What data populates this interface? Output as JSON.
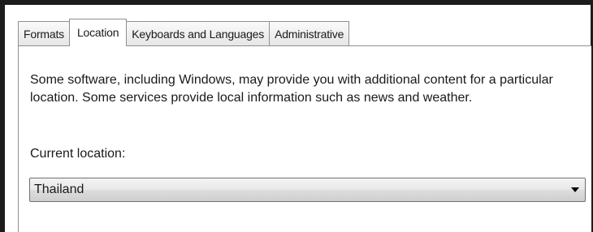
{
  "tabs": [
    {
      "label": "Formats",
      "active": false
    },
    {
      "label": "Location",
      "active": true
    },
    {
      "label": "Keyboards and Languages",
      "active": false
    },
    {
      "label": "Administrative",
      "active": false
    }
  ],
  "location_tab": {
    "description": "Some software, including Windows, may provide you with additional content for a particular location. Some services provide local information such as news and weather.",
    "current_location_label": "Current location:",
    "current_location_value": "Thailand",
    "dropdown_icon": "chevron-down-icon"
  }
}
